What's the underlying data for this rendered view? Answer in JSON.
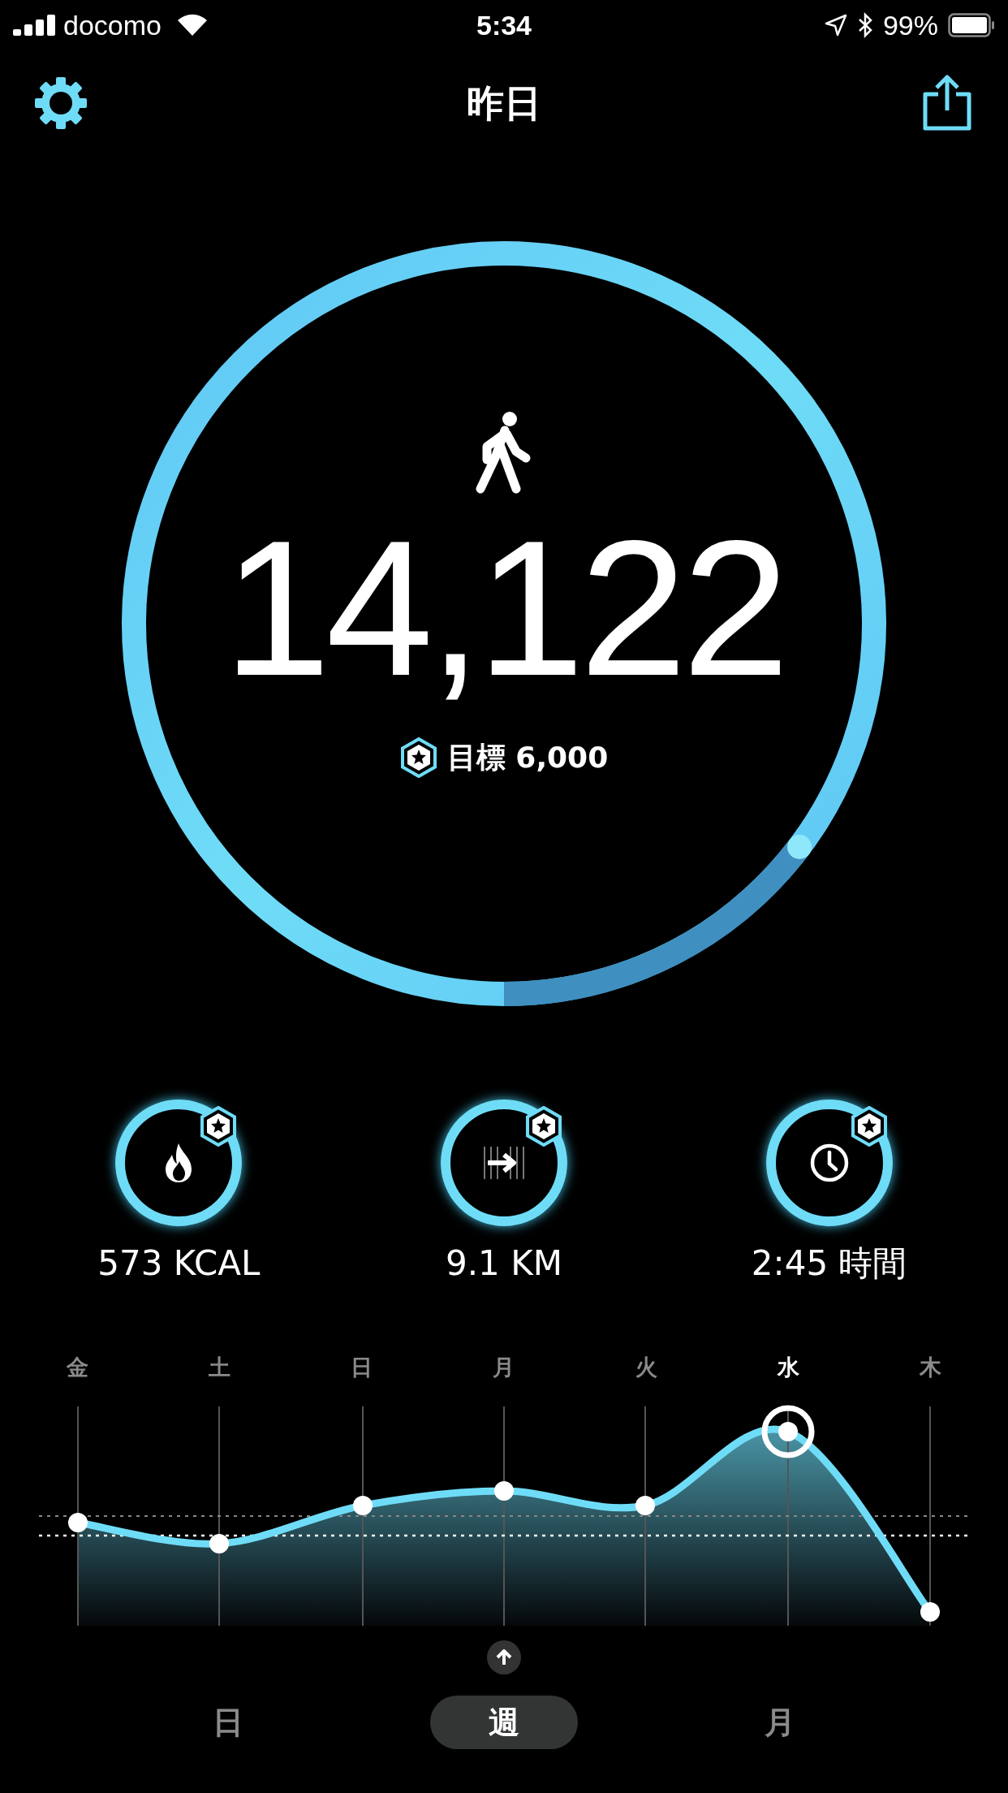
{
  "status_bar": {
    "carrier": "docomo",
    "time": "5:34",
    "battery": "99%"
  },
  "header": {
    "title": "昨日"
  },
  "steps": {
    "value": "14,122",
    "goal": "目標 6,000"
  },
  "stats": [
    {
      "kind": "calories",
      "value": "573 KCAL"
    },
    {
      "kind": "distance",
      "value": "9.1 KM"
    },
    {
      "kind": "time",
      "value": "2:45 時間"
    }
  ],
  "week_chart": {
    "days": [
      {
        "label": "金",
        "selected": false
      },
      {
        "label": "土",
        "selected": false
      },
      {
        "label": "日",
        "selected": false
      },
      {
        "label": "月",
        "selected": false
      },
      {
        "label": "火",
        "selected": false
      },
      {
        "label": "水",
        "selected": true
      },
      {
        "label": "木",
        "selected": false
      }
    ]
  },
  "period_tabs": [
    {
      "label": "日",
      "selected": false
    },
    {
      "label": "週",
      "selected": true
    },
    {
      "label": "月",
      "selected": false
    }
  ]
}
